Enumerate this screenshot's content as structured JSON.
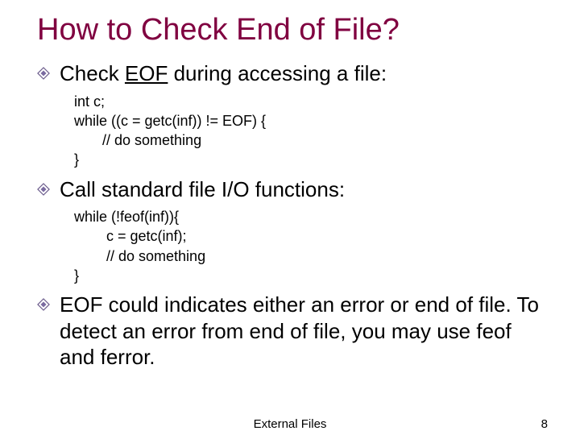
{
  "title": "How to Check End of File?",
  "bullets": {
    "b1_pre": "Check ",
    "b1_u": "EOF",
    "b1_post": " during accessing a file:",
    "b2": "Call standard file I/O functions:",
    "b3": "EOF could indicates either an error or end of file. To detect an error from end of file, you may use feof and ferror."
  },
  "code": {
    "c1": "int c;\nwhile ((c = getc(inf)) != EOF) {\n       // do something\n}",
    "c2": "while (!feof(inf)){\n        c = getc(inf);\n        // do something\n}"
  },
  "footer": {
    "center": "External Files",
    "page": "8"
  },
  "colors": {
    "title": "#800040",
    "bullet_border": "#6a5a8a",
    "bullet_fill": "#7a6aa0"
  }
}
